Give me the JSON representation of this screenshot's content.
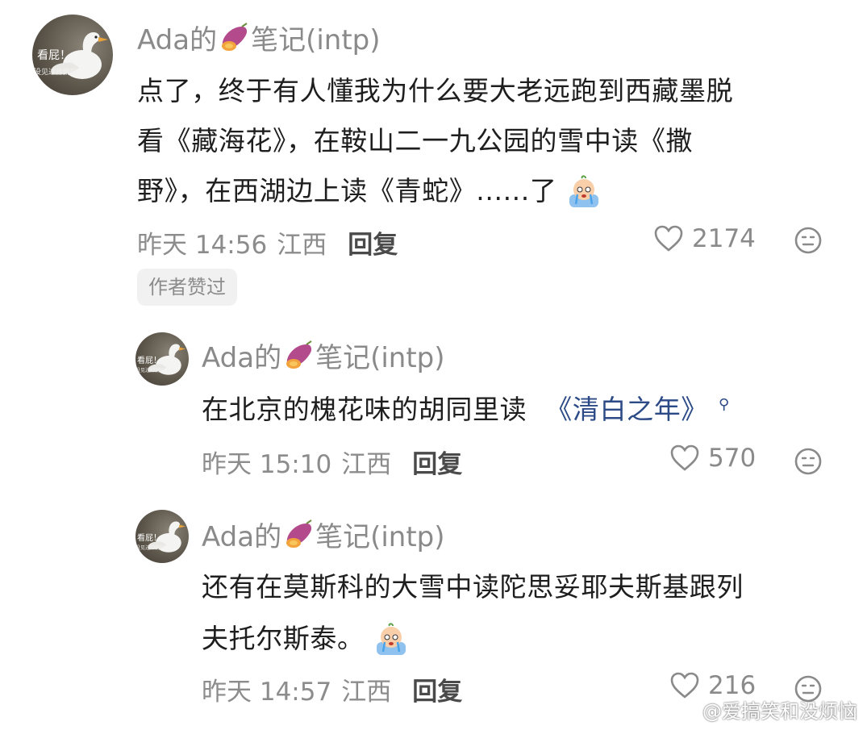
{
  "comments": [
    {
      "username_prefix": "Ada的",
      "username_suffix": "笔记(intp)",
      "avatar_text_top": "看屁！",
      "avatar_text_bottom": "没见过帅鹅吗",
      "body_lines": [
        "点了，终于有人懂我为什么要大老远跑到西藏墨脱",
        "看《藏海花》，在鞍山二一九公园的雪中读《撒",
        "野》，在西湖边上读《青蛇》......了"
      ],
      "time": "昨天 14:56",
      "location": "江西",
      "reply_label": "回复",
      "likes": "2174",
      "author_badge": "作者赞过"
    },
    {
      "username_prefix": "Ada的",
      "username_suffix": "笔记(intp)",
      "avatar_text_top": "看屁！",
      "avatar_text_bottom": "没见过帅鹅吗",
      "body_plain": "在北京的槐花味的胡同里读",
      "body_link": "《清白之年》",
      "time": "昨天 15:10",
      "location": "江西",
      "reply_label": "回复",
      "likes": "570"
    },
    {
      "username_prefix": "Ada的",
      "username_suffix": "笔记(intp)",
      "avatar_text_top": "看屁！",
      "avatar_text_bottom": "没见过帅鹅吗",
      "body_lines": [
        "还有在莫斯科的大雪中读陀思妥耶夫斯基跟列",
        "夫托尔斯泰。"
      ],
      "time": "昨天 14:57",
      "location": "江西",
      "reply_label": "回复",
      "likes": "216"
    }
  ],
  "watermark": "@爱搞笑和没烦恼",
  "icons": {
    "like": "heart-outline-icon",
    "dislike": "neutral-face-icon",
    "sweet_potato": "sweet-potato-icon",
    "crying": "crying-emoji-icon",
    "search_link": "search-icon"
  },
  "colors": {
    "username": "#8a8a8a",
    "body": "#1e1e1e",
    "meta": "#8c8c8c",
    "link": "#2b4a86",
    "badge_bg": "#f1f1f1"
  }
}
